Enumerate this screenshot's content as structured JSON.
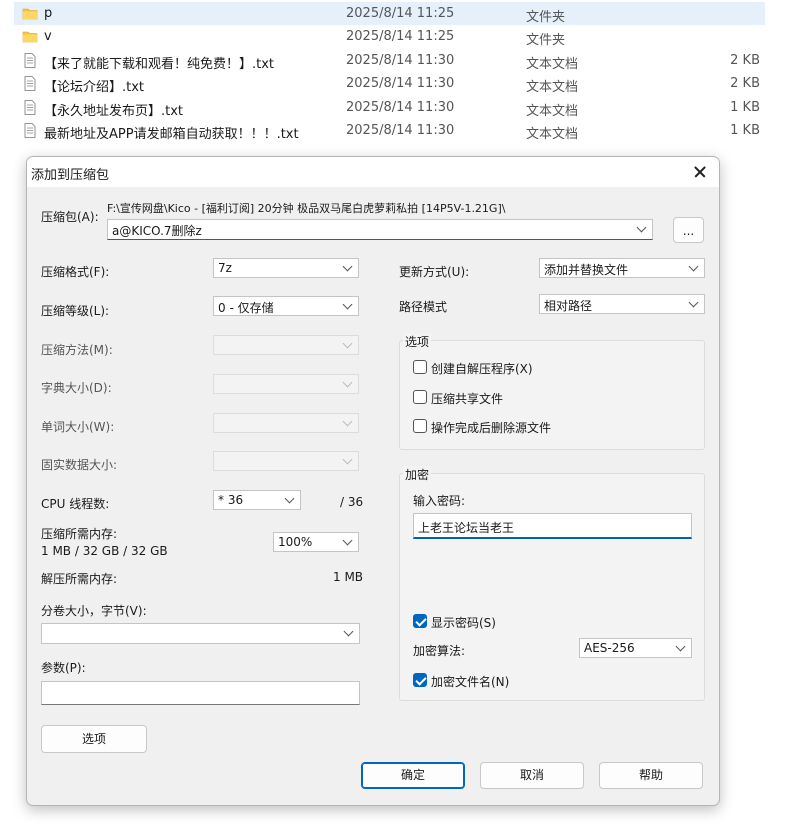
{
  "file_list": [
    {
      "icon": "folder-icon",
      "name": "p",
      "date": "2025/8/14 11:25",
      "type": "文件夹",
      "size": ""
    },
    {
      "icon": "folder-icon",
      "name": "v",
      "date": "2025/8/14 11:25",
      "type": "文件夹",
      "size": ""
    },
    {
      "icon": "text-file-icon",
      "name": "【来了就能下载和观看！纯免费！】.txt",
      "date": "2025/8/14 11:30",
      "type": "文本文档",
      "size": "2 KB"
    },
    {
      "icon": "text-file-icon",
      "name": "【论坛介绍】.txt",
      "date": "2025/8/14 11:30",
      "type": "文本文档",
      "size": "2 KB"
    },
    {
      "icon": "text-file-icon",
      "name": "【永久地址发布页】.txt",
      "date": "2025/8/14 11:30",
      "type": "文本文档",
      "size": "1 KB"
    },
    {
      "icon": "text-file-icon",
      "name": "最新地址及APP请发邮箱自动获取！！！.txt",
      "date": "2025/8/14 11:30",
      "type": "文本文档",
      "size": "1 KB"
    }
  ],
  "dialog": {
    "title": "添加到压缩包",
    "archive": {
      "label": "压缩包(A):",
      "path": "F:\\宣传网盘\\Kico - [福利订阅] 20分钟 极品双马尾白虎萝莉私拍 [14P5V-1.21G]\\",
      "name": "a@KICO.7删除z",
      "browse_label": "..."
    },
    "format": {
      "label": "压缩格式(F):",
      "value": "7z"
    },
    "level": {
      "label": "压缩等级(L):",
      "value": "0 - 仅存储"
    },
    "method": {
      "label": "压缩方法(M):",
      "value": ""
    },
    "dict": {
      "label": "字典大小(D):",
      "value": ""
    },
    "word": {
      "label": "单词大小(W):",
      "value": ""
    },
    "solid": {
      "label": "固实数据大小:",
      "value": ""
    },
    "threads": {
      "label": "CPU 线程数:",
      "value": "* 36",
      "total": "/ 36"
    },
    "mem_compress": {
      "label": "压缩所需内存:",
      "value": "1 MB / 32 GB / 32 GB",
      "percent": "100%"
    },
    "mem_decompress": {
      "label": "解压所需内存:",
      "value": "1 MB"
    },
    "split": {
      "label": "分卷大小，字节(V):",
      "value": ""
    },
    "params": {
      "label": "参数(P):",
      "value": ""
    },
    "options_button": "选项",
    "update_mode": {
      "label": "更新方式(U):",
      "value": "添加并替换文件"
    },
    "path_mode": {
      "label": "路径模式",
      "value": "相对路径"
    },
    "options_group": {
      "title": "选项",
      "sfx": {
        "label": "创建自解压程序(X)",
        "checked": false
      },
      "shared": {
        "label": "压缩共享文件",
        "checked": false
      },
      "delete_after": {
        "label": "操作完成后删除源文件",
        "checked": false
      }
    },
    "encryption": {
      "title": "加密",
      "password_label": "输入密码:",
      "password_value": "上老王论坛当老王",
      "show_password": {
        "label": "显示密码(S)",
        "checked": true
      },
      "method_label": "加密算法:",
      "method_value": "AES-256",
      "encrypt_names": {
        "label": "加密文件名(N)",
        "checked": true
      }
    },
    "buttons": {
      "ok": "确定",
      "cancel": "取消",
      "help": "帮助"
    }
  },
  "colors": {
    "accent": "#0067c0",
    "selected_row": "#e5f0fb",
    "folder": "#f5c242"
  }
}
